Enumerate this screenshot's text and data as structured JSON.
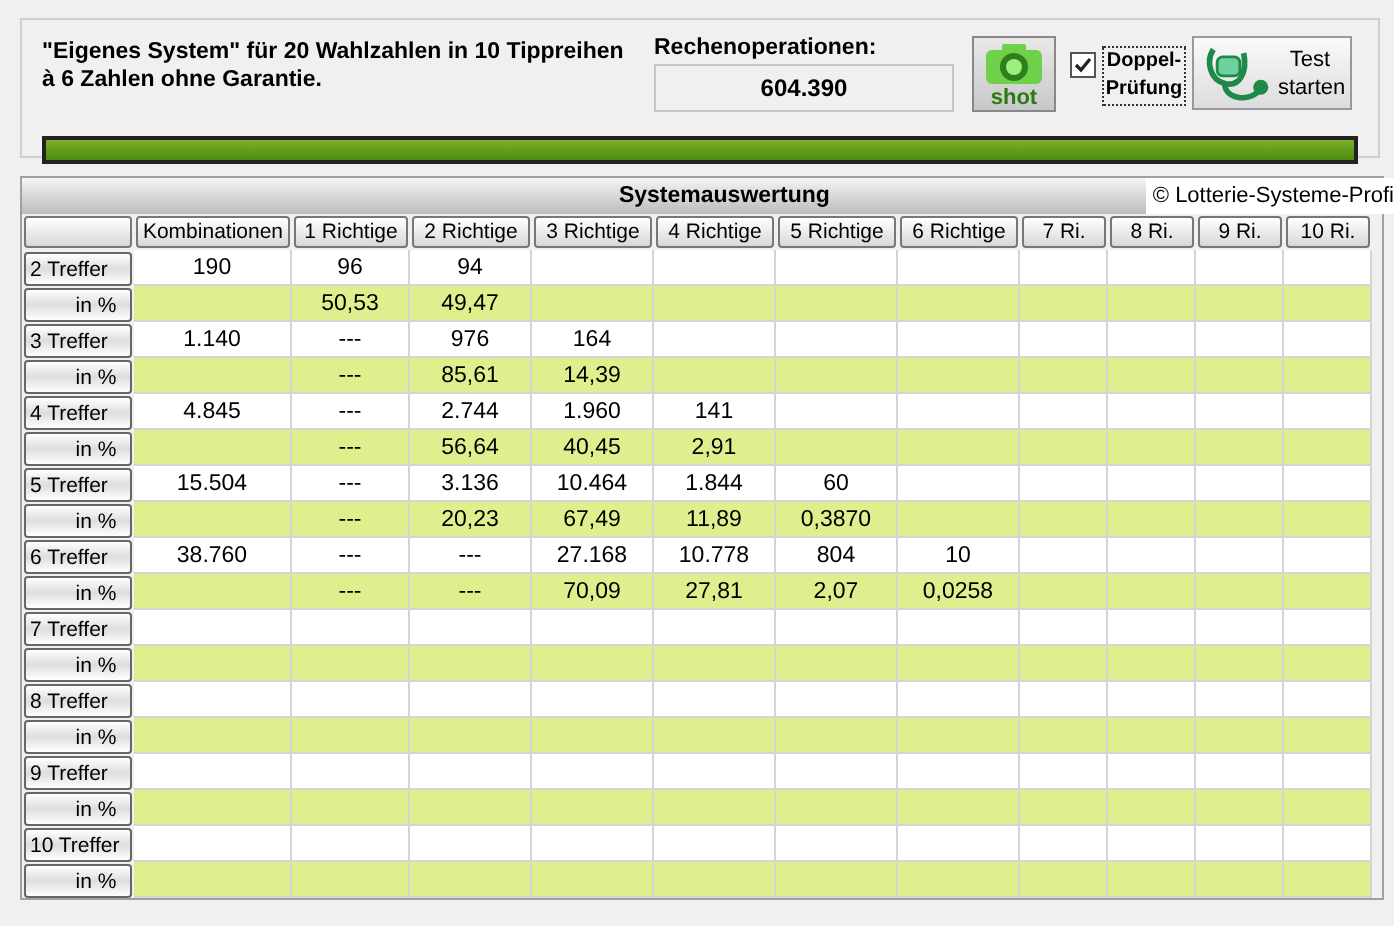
{
  "summary": {
    "text": "\"Eigenes System\" für 20 Wahlzahlen in 10 Tippreihen à 6 Zahlen ohne Garantie.",
    "operations_label": "Rechenoperationen:",
    "operations_value": "604.390"
  },
  "shot_button": {
    "label": "shot"
  },
  "double_check": {
    "label": "Doppel-Prüfung",
    "checked": true
  },
  "test_button": {
    "label": "Test starten"
  },
  "progress": {
    "level": 1
  },
  "table": {
    "title": "Systemauswertung",
    "copyright": "© Lotterie-Systeme-Profi",
    "columns": [
      "Kombinationen",
      "1 Richtige",
      "2 Richtige",
      "3 Richtige",
      "4 Richtige",
      "5 Richtige",
      "6 Richtige",
      "7 Ri.",
      "8 Ri.",
      "9 Ri.",
      "10 Ri."
    ],
    "rows": [
      {
        "kind": "count",
        "label": "2 Treffer",
        "cells": [
          "190",
          "96",
          "94",
          null,
          null,
          null,
          null,
          null,
          null,
          null,
          null
        ]
      },
      {
        "kind": "percent",
        "label": "in %",
        "cells": [
          null,
          "50,53",
          "49,47",
          null,
          null,
          null,
          null,
          null,
          null,
          null,
          null
        ]
      },
      {
        "kind": "count",
        "label": "3 Treffer",
        "cells": [
          "1.140",
          "---",
          "976",
          "164",
          null,
          null,
          null,
          null,
          null,
          null,
          null
        ]
      },
      {
        "kind": "percent",
        "label": "in %",
        "cells": [
          null,
          "---",
          "85,61",
          "14,39",
          null,
          null,
          null,
          null,
          null,
          null,
          null
        ]
      },
      {
        "kind": "count",
        "label": "4 Treffer",
        "cells": [
          "4.845",
          "---",
          "2.744",
          "1.960",
          "141",
          null,
          null,
          null,
          null,
          null,
          null
        ]
      },
      {
        "kind": "percent",
        "label": "in %",
        "cells": [
          null,
          "---",
          "56,64",
          "40,45",
          "2,91",
          null,
          null,
          null,
          null,
          null,
          null
        ]
      },
      {
        "kind": "count",
        "label": "5 Treffer",
        "cells": [
          "15.504",
          "---",
          "3.136",
          "10.464",
          "1.844",
          "60",
          null,
          null,
          null,
          null,
          null
        ]
      },
      {
        "kind": "percent",
        "label": "in %",
        "cells": [
          null,
          "---",
          "20,23",
          "67,49",
          "11,89",
          "0,3870",
          null,
          null,
          null,
          null,
          null
        ]
      },
      {
        "kind": "count",
        "label": "6 Treffer",
        "cells": [
          "38.760",
          "---",
          "---",
          "27.168",
          "10.778",
          "804",
          "10",
          null,
          null,
          null,
          null
        ]
      },
      {
        "kind": "percent",
        "label": "in %",
        "cells": [
          null,
          "---",
          "---",
          "70,09",
          "27,81",
          "2,07",
          "0,0258",
          null,
          null,
          null,
          null
        ]
      },
      {
        "kind": "count",
        "label": "7 Treffer",
        "cells": [
          null,
          null,
          null,
          null,
          null,
          null,
          null,
          null,
          null,
          null,
          null
        ]
      },
      {
        "kind": "percent",
        "label": "in %",
        "cells": [
          null,
          null,
          null,
          null,
          null,
          null,
          null,
          null,
          null,
          null,
          null
        ]
      },
      {
        "kind": "count",
        "label": "8 Treffer",
        "cells": [
          null,
          null,
          null,
          null,
          null,
          null,
          null,
          null,
          null,
          null,
          null
        ]
      },
      {
        "kind": "percent",
        "label": "in %",
        "cells": [
          null,
          null,
          null,
          null,
          null,
          null,
          null,
          null,
          null,
          null,
          null
        ]
      },
      {
        "kind": "count",
        "label": "9 Treffer",
        "cells": [
          null,
          null,
          null,
          null,
          null,
          null,
          null,
          null,
          null,
          null,
          null
        ]
      },
      {
        "kind": "percent",
        "label": "in %",
        "cells": [
          null,
          null,
          null,
          null,
          null,
          null,
          null,
          null,
          null,
          null,
          null
        ]
      },
      {
        "kind": "count",
        "label": "10 Treffer",
        "cells": [
          null,
          null,
          null,
          null,
          null,
          null,
          null,
          null,
          null,
          null,
          null
        ]
      },
      {
        "kind": "percent",
        "label": "in %",
        "cells": [
          null,
          null,
          null,
          null,
          null,
          null,
          null,
          null,
          null,
          null,
          null
        ]
      }
    ]
  }
}
